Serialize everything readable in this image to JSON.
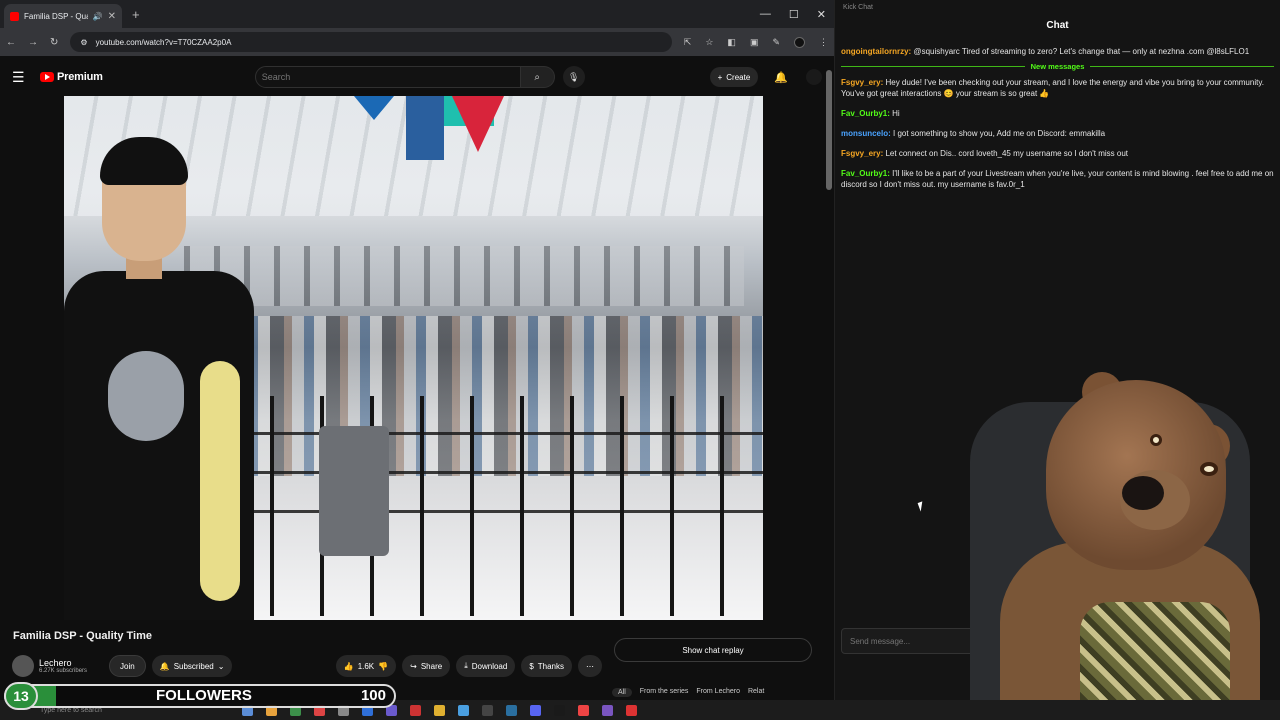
{
  "browser": {
    "tab_title": "Familia DSP - Quality Time",
    "url": "youtube.com/watch?v=T70CZAA2p0A"
  },
  "youtube": {
    "logo_text": "Premium",
    "search_placeholder": "Search",
    "create_label": "Create",
    "video_title": "Familia DSP - Quality Time",
    "channel_name": "Lechero",
    "channel_subs": "6.27K subscribers",
    "join_label": "Join",
    "subscribed_label": "Subscribed",
    "like_count": "1.6K",
    "share_label": "Share",
    "download_label": "Download",
    "thanks_label": "Thanks",
    "chat_replay_label": "Show chat replay",
    "chips": [
      "All",
      "From the series",
      "From Lechero",
      "Relat"
    ]
  },
  "chat": {
    "window_title": "Kick Chat",
    "header": "Chat",
    "new_messages_label": "New messages",
    "send_placeholder": "Send message...",
    "messages": [
      {
        "user": "ongoingtailornrzy:",
        "text": " @squishyarc Tired of streaming to zero? Let's change that — only at nezhna .com @l8sLFLO1",
        "color": "#f5a623"
      },
      {
        "user": "Fsgvy_ery:",
        "text": " Hey dude! I've been checking out your stream, and I love the energy and vibe you bring to your community. You've got great interactions 😊 your stream is so great 👍",
        "color": "#f5a623"
      },
      {
        "user": "Fav_Ourby1:",
        "text": " Hi",
        "color": "#53fc18"
      },
      {
        "user": "monsuncelo:",
        "text": " I got something to show you, Add me on Discord: emmakilla",
        "color": "#4aa3ff"
      },
      {
        "user": "Fsgvy_ery:",
        "text": " Let connect on Dis.. cord loveth_45 my username so I don't miss out",
        "color": "#f5a623"
      },
      {
        "user": "Fav_Ourby1:",
        "text": " I'll like to be a part of your Livestream when you're live, your content is mind blowing . feel free to add me on discord so I don't miss out. my username is fav.0r_1",
        "color": "#53fc18"
      }
    ]
  },
  "followers": {
    "current": "13",
    "label": "FOLLOWERS",
    "goal": "100",
    "progress_fraction": 0.13
  },
  "taskbar": {
    "search_text": "Type here to search"
  }
}
